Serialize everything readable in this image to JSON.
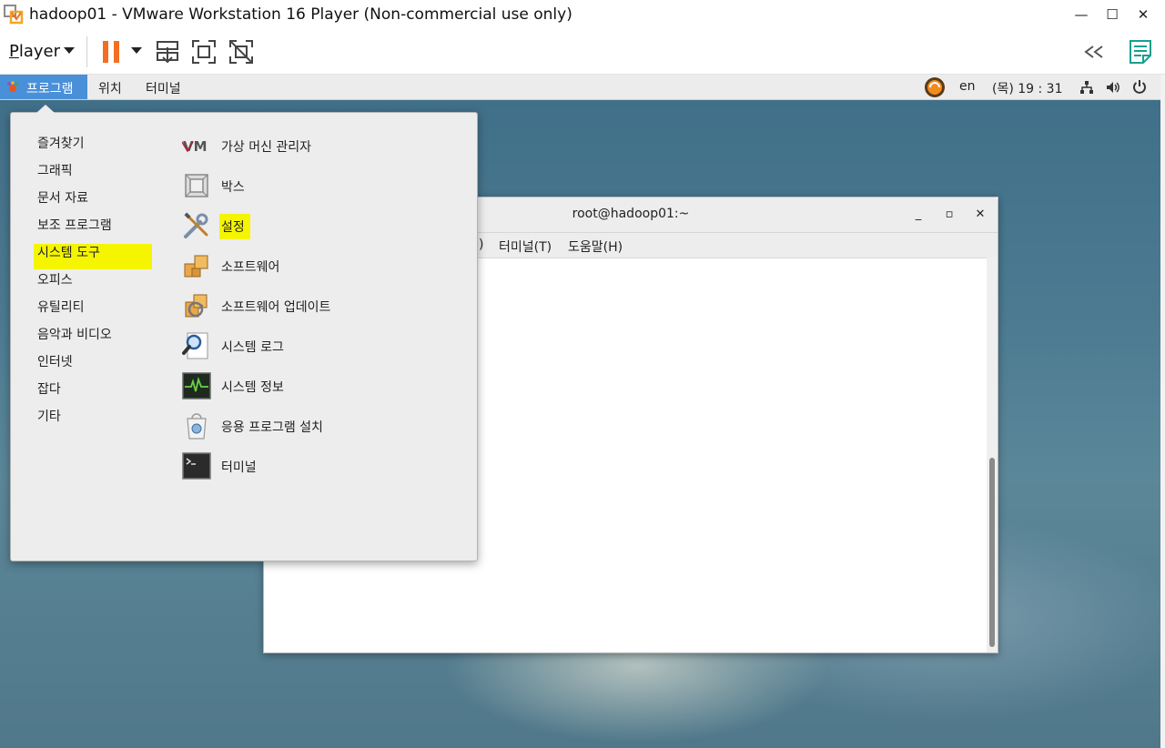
{
  "vmware": {
    "title": "hadoop01 - VMware Workstation 16 Player (Non-commercial use only)",
    "player_menu": "Player",
    "player_menu_mnemonic": "P",
    "player_menu_rest": "layer"
  },
  "guest_panel": {
    "apps_label": "프로그램",
    "places_label": "위치",
    "terminal_label": "터미널",
    "lang": "en",
    "clock": "(목) 19 : 31"
  },
  "terminal": {
    "title": "root@hadoop01:~",
    "menus": [
      ")",
      "터미널(T)",
      "도움말(H)"
    ]
  },
  "app_menu": {
    "categories": [
      "즐겨찾기",
      "그래픽",
      "문서 자료",
      "보조 프로그램",
      "시스템 도구",
      "오피스",
      "유틸리티",
      "음악과 비디오",
      "인터넷",
      "잡다",
      "기타"
    ],
    "selected_category": "시스템 도구",
    "apps": [
      {
        "label": "가상 머신 관리자",
        "icon": "virt-manager-icon"
      },
      {
        "label": "박스",
        "icon": "boxes-icon"
      },
      {
        "label": "설정",
        "icon": "settings-tools-icon"
      },
      {
        "label": "소프트웨어",
        "icon": "software-icon"
      },
      {
        "label": "소프트웨어 업데이트",
        "icon": "software-update-icon"
      },
      {
        "label": "시스템 로그",
        "icon": "system-log-icon"
      },
      {
        "label": "시스템 정보",
        "icon": "system-monitor-icon"
      },
      {
        "label": "응용 프로그램 설치",
        "icon": "app-install-icon"
      },
      {
        "label": "터미널",
        "icon": "terminal-icon"
      }
    ]
  },
  "colors": {
    "panel_apps_bg": "#4a90d9",
    "highlight": "#f5f500",
    "vmware_orange": "#f26f21"
  }
}
